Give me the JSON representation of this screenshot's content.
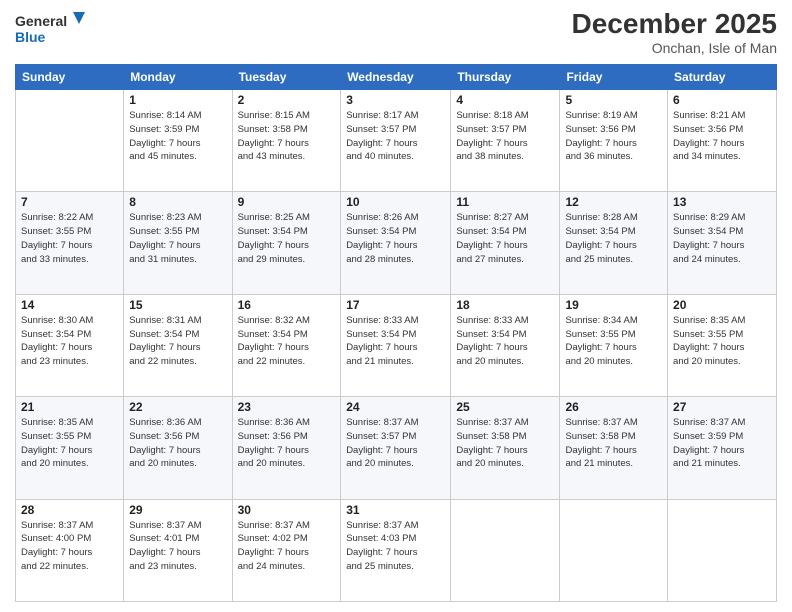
{
  "logo": {
    "line1": "General",
    "line2": "Blue"
  },
  "title": "December 2025",
  "location": "Onchan, Isle of Man",
  "days_of_week": [
    "Sunday",
    "Monday",
    "Tuesday",
    "Wednesday",
    "Thursday",
    "Friday",
    "Saturday"
  ],
  "weeks": [
    [
      {
        "day": "",
        "info": ""
      },
      {
        "day": "1",
        "info": "Sunrise: 8:14 AM\nSunset: 3:59 PM\nDaylight: 7 hours\nand 45 minutes."
      },
      {
        "day": "2",
        "info": "Sunrise: 8:15 AM\nSunset: 3:58 PM\nDaylight: 7 hours\nand 43 minutes."
      },
      {
        "day": "3",
        "info": "Sunrise: 8:17 AM\nSunset: 3:57 PM\nDaylight: 7 hours\nand 40 minutes."
      },
      {
        "day": "4",
        "info": "Sunrise: 8:18 AM\nSunset: 3:57 PM\nDaylight: 7 hours\nand 38 minutes."
      },
      {
        "day": "5",
        "info": "Sunrise: 8:19 AM\nSunset: 3:56 PM\nDaylight: 7 hours\nand 36 minutes."
      },
      {
        "day": "6",
        "info": "Sunrise: 8:21 AM\nSunset: 3:56 PM\nDaylight: 7 hours\nand 34 minutes."
      }
    ],
    [
      {
        "day": "7",
        "info": "Sunrise: 8:22 AM\nSunset: 3:55 PM\nDaylight: 7 hours\nand 33 minutes."
      },
      {
        "day": "8",
        "info": "Sunrise: 8:23 AM\nSunset: 3:55 PM\nDaylight: 7 hours\nand 31 minutes."
      },
      {
        "day": "9",
        "info": "Sunrise: 8:25 AM\nSunset: 3:54 PM\nDaylight: 7 hours\nand 29 minutes."
      },
      {
        "day": "10",
        "info": "Sunrise: 8:26 AM\nSunset: 3:54 PM\nDaylight: 7 hours\nand 28 minutes."
      },
      {
        "day": "11",
        "info": "Sunrise: 8:27 AM\nSunset: 3:54 PM\nDaylight: 7 hours\nand 27 minutes."
      },
      {
        "day": "12",
        "info": "Sunrise: 8:28 AM\nSunset: 3:54 PM\nDaylight: 7 hours\nand 25 minutes."
      },
      {
        "day": "13",
        "info": "Sunrise: 8:29 AM\nSunset: 3:54 PM\nDaylight: 7 hours\nand 24 minutes."
      }
    ],
    [
      {
        "day": "14",
        "info": "Sunrise: 8:30 AM\nSunset: 3:54 PM\nDaylight: 7 hours\nand 23 minutes."
      },
      {
        "day": "15",
        "info": "Sunrise: 8:31 AM\nSunset: 3:54 PM\nDaylight: 7 hours\nand 22 minutes."
      },
      {
        "day": "16",
        "info": "Sunrise: 8:32 AM\nSunset: 3:54 PM\nDaylight: 7 hours\nand 22 minutes."
      },
      {
        "day": "17",
        "info": "Sunrise: 8:33 AM\nSunset: 3:54 PM\nDaylight: 7 hours\nand 21 minutes."
      },
      {
        "day": "18",
        "info": "Sunrise: 8:33 AM\nSunset: 3:54 PM\nDaylight: 7 hours\nand 20 minutes."
      },
      {
        "day": "19",
        "info": "Sunrise: 8:34 AM\nSunset: 3:55 PM\nDaylight: 7 hours\nand 20 minutes."
      },
      {
        "day": "20",
        "info": "Sunrise: 8:35 AM\nSunset: 3:55 PM\nDaylight: 7 hours\nand 20 minutes."
      }
    ],
    [
      {
        "day": "21",
        "info": "Sunrise: 8:35 AM\nSunset: 3:55 PM\nDaylight: 7 hours\nand 20 minutes."
      },
      {
        "day": "22",
        "info": "Sunrise: 8:36 AM\nSunset: 3:56 PM\nDaylight: 7 hours\nand 20 minutes."
      },
      {
        "day": "23",
        "info": "Sunrise: 8:36 AM\nSunset: 3:56 PM\nDaylight: 7 hours\nand 20 minutes."
      },
      {
        "day": "24",
        "info": "Sunrise: 8:37 AM\nSunset: 3:57 PM\nDaylight: 7 hours\nand 20 minutes."
      },
      {
        "day": "25",
        "info": "Sunrise: 8:37 AM\nSunset: 3:58 PM\nDaylight: 7 hours\nand 20 minutes."
      },
      {
        "day": "26",
        "info": "Sunrise: 8:37 AM\nSunset: 3:58 PM\nDaylight: 7 hours\nand 21 minutes."
      },
      {
        "day": "27",
        "info": "Sunrise: 8:37 AM\nSunset: 3:59 PM\nDaylight: 7 hours\nand 21 minutes."
      }
    ],
    [
      {
        "day": "28",
        "info": "Sunrise: 8:37 AM\nSunset: 4:00 PM\nDaylight: 7 hours\nand 22 minutes."
      },
      {
        "day": "29",
        "info": "Sunrise: 8:37 AM\nSunset: 4:01 PM\nDaylight: 7 hours\nand 23 minutes."
      },
      {
        "day": "30",
        "info": "Sunrise: 8:37 AM\nSunset: 4:02 PM\nDaylight: 7 hours\nand 24 minutes."
      },
      {
        "day": "31",
        "info": "Sunrise: 8:37 AM\nSunset: 4:03 PM\nDaylight: 7 hours\nand 25 minutes."
      },
      {
        "day": "",
        "info": ""
      },
      {
        "day": "",
        "info": ""
      },
      {
        "day": "",
        "info": ""
      }
    ]
  ]
}
